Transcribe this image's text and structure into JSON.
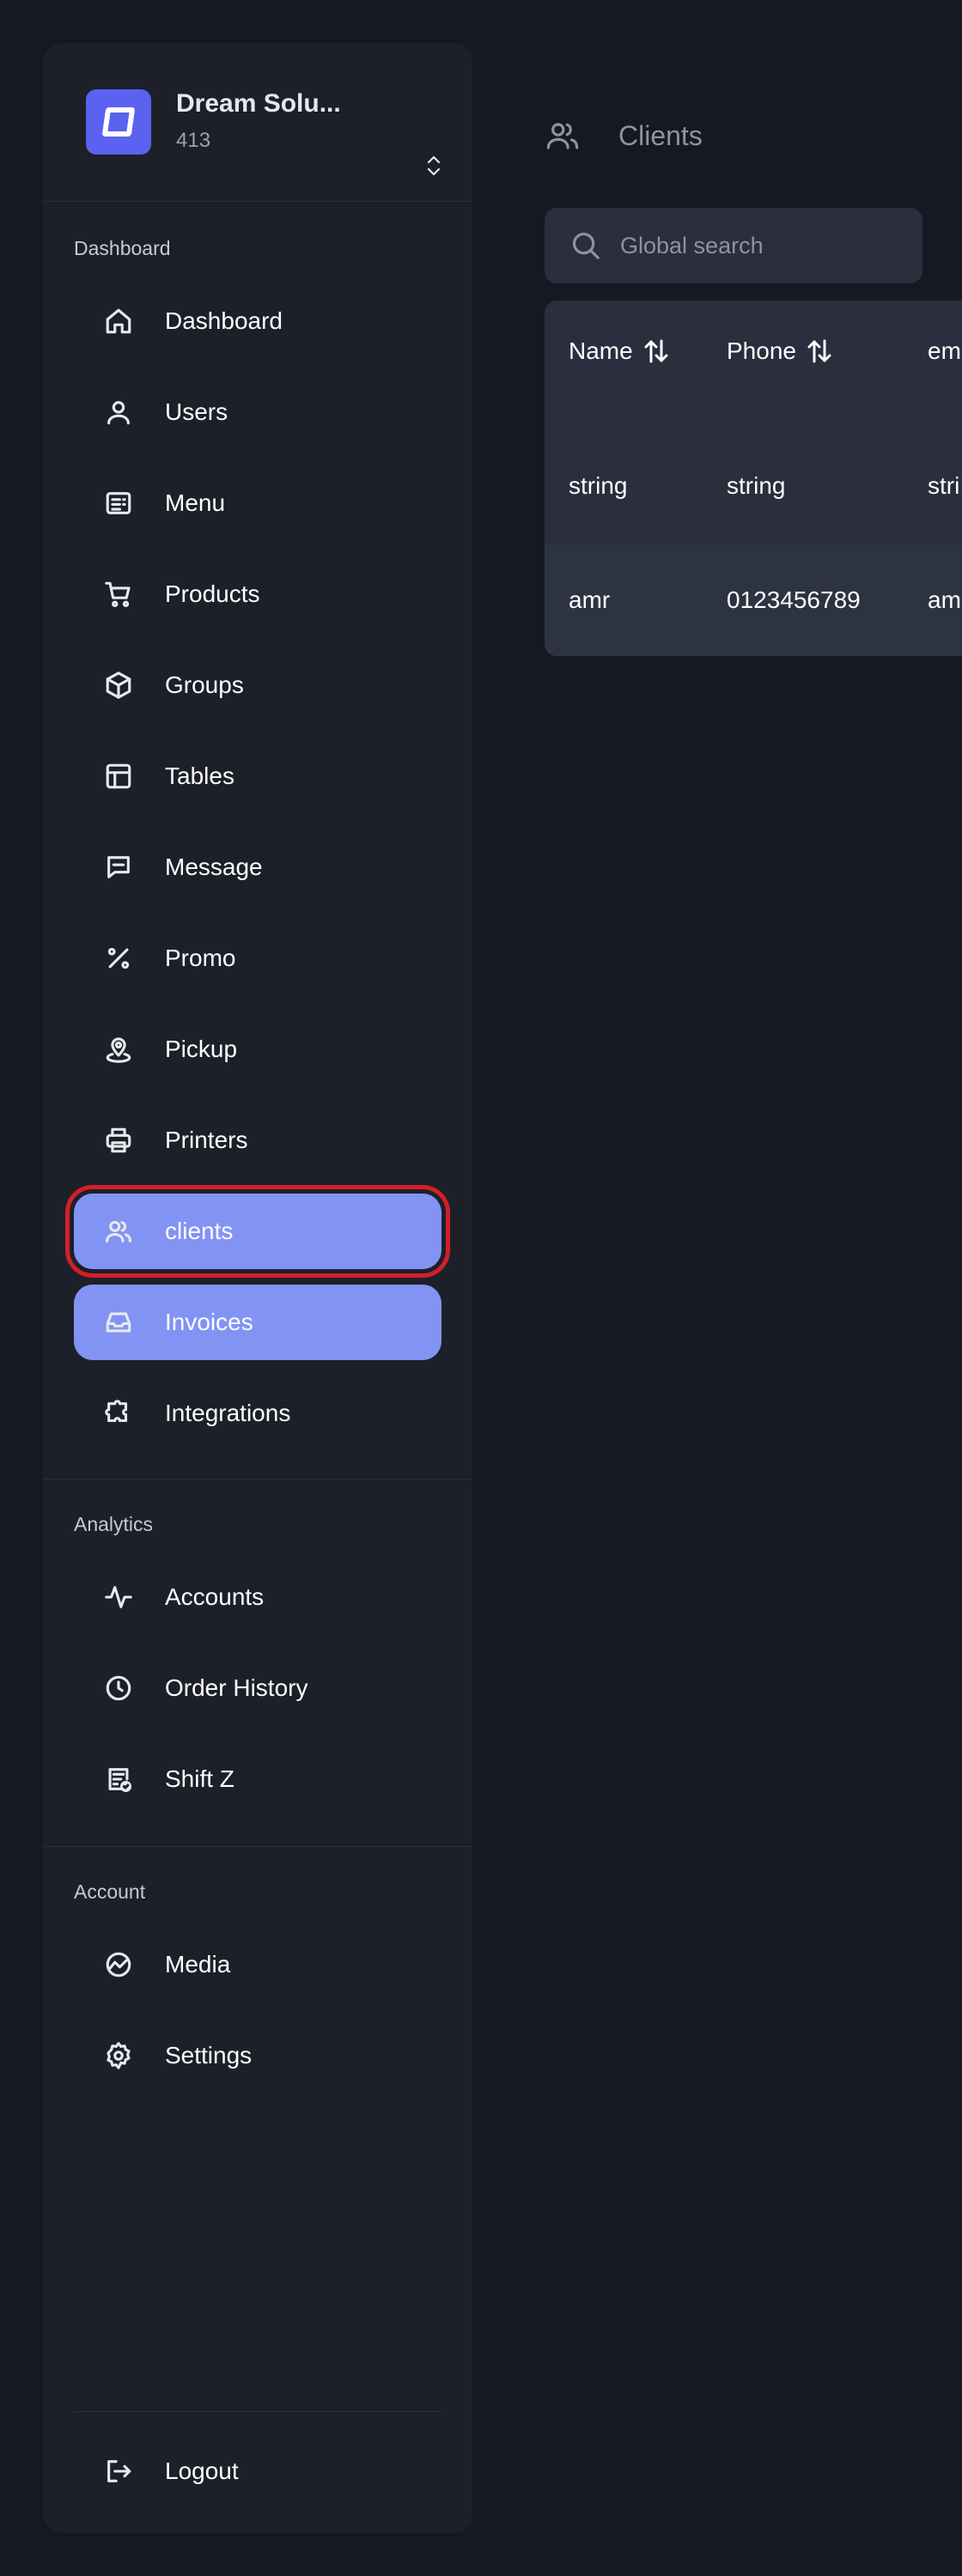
{
  "brand": {
    "name": "Dream Solu...",
    "sub": "413"
  },
  "sections": {
    "dashboard": "Dashboard",
    "analytics": "Analytics",
    "account": "Account"
  },
  "sidebar": {
    "items": [
      {
        "label": "Dashboard",
        "icon": "home-icon"
      },
      {
        "label": "Users",
        "icon": "user-icon"
      },
      {
        "label": "Menu",
        "icon": "menu-card-icon"
      },
      {
        "label": "Products",
        "icon": "cart-icon"
      },
      {
        "label": "Groups",
        "icon": "box-icon"
      },
      {
        "label": "Tables",
        "icon": "table-icon"
      },
      {
        "label": "Message",
        "icon": "message-icon"
      },
      {
        "label": "Promo",
        "icon": "percent-icon"
      },
      {
        "label": "Pickup",
        "icon": "map-pin-icon"
      },
      {
        "label": "Printers",
        "icon": "printer-icon"
      },
      {
        "label": "clients",
        "icon": "users-icon"
      },
      {
        "label": "Invoices",
        "icon": "inbox-icon"
      },
      {
        "label": "Integrations",
        "icon": "puzzle-icon"
      }
    ],
    "analytics_items": [
      {
        "label": "Accounts",
        "icon": "activity-icon"
      },
      {
        "label": "Order History",
        "icon": "clock-icon"
      },
      {
        "label": "Shift Z",
        "icon": "report-check-icon"
      }
    ],
    "account_items": [
      {
        "label": "Media",
        "icon": "chart-circle-icon"
      },
      {
        "label": "Settings",
        "icon": "gear-icon"
      }
    ],
    "logout": "Logout"
  },
  "main": {
    "title": "Clients",
    "search": {
      "placeholder": "Global search",
      "value": ""
    },
    "table": {
      "columns": [
        "Name",
        "Phone",
        "em"
      ],
      "filter_row": [
        "string",
        "string",
        "stri"
      ],
      "rows": [
        [
          "amr",
          "0123456789",
          "am"
        ]
      ]
    }
  },
  "colors": {
    "background": "#161922",
    "sidebar": "#1d2029",
    "accent": "#8393f4",
    "brand": "#5b62f0",
    "focus_ring": "#d21f2a"
  }
}
